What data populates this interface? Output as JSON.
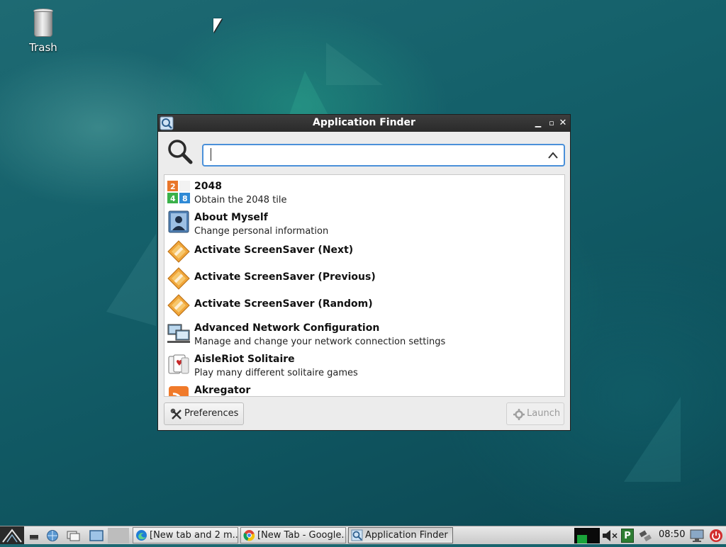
{
  "desktop": {
    "icons": [
      {
        "label": "Trash",
        "icon": "trash-icon"
      }
    ]
  },
  "window": {
    "title": "Application Finder",
    "controls": {
      "minimize": "minimize-icon",
      "maximize": "maximize-icon",
      "close": "close-icon"
    },
    "search": {
      "value": "",
      "placeholder": ""
    },
    "apps": [
      {
        "name": "2048",
        "description": "Obtain the 2048 tile",
        "icon": "2048-icon"
      },
      {
        "name": "About Myself",
        "description": "Change personal information",
        "icon": "user-icon"
      },
      {
        "name": "Activate ScreenSaver (Next)",
        "description": "",
        "icon": "screensaver-icon"
      },
      {
        "name": "Activate ScreenSaver (Previous)",
        "description": "",
        "icon": "screensaver-icon"
      },
      {
        "name": "Activate ScreenSaver (Random)",
        "description": "",
        "icon": "screensaver-icon"
      },
      {
        "name": "Advanced Network Configuration",
        "description": "Manage and change your network connection settings",
        "icon": "network-icon"
      },
      {
        "name": "AisleRiot Solitaire",
        "description": "Play many different solitaire games",
        "icon": "cards-icon"
      },
      {
        "name": "Akregator",
        "description": "",
        "icon": "rss-icon"
      }
    ],
    "buttons": {
      "preferences": "Preferences",
      "launch": "Launch"
    }
  },
  "taskbar": {
    "tasks": [
      {
        "label": "[New tab and 2 m...",
        "icon": "edge-icon"
      },
      {
        "label": "[New Tab - Google...",
        "icon": "chrome-icon"
      },
      {
        "label": "Application Finder",
        "icon": "app-finder-icon"
      }
    ],
    "clock": "08:50"
  }
}
